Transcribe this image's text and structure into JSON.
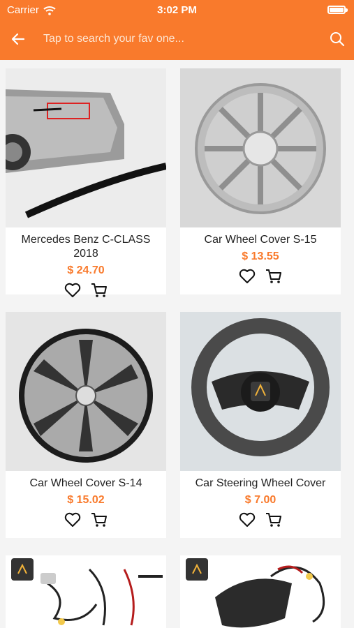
{
  "status_bar": {
    "carrier": "Carrier",
    "time": "3:02 PM"
  },
  "search": {
    "placeholder": "Tap to search your fav one..."
  },
  "colors": {
    "accent": "#f97a2c"
  },
  "products": [
    {
      "name": "Mercedes Benz C-CLASS 2018",
      "price": "$ 24.70",
      "image": "car-spoiler"
    },
    {
      "name": "Car Wheel Cover S-15",
      "price": "$ 13.55",
      "image": "silver-wheel-cover"
    },
    {
      "name": "Car Wheel Cover S-14",
      "price": "$ 15.02",
      "image": "chrome-wheel-cover"
    },
    {
      "name": "Car Steering Wheel Cover",
      "price": "$ 7.00",
      "image": "steering-wheel-cover"
    },
    {
      "name": "",
      "price": "",
      "image": "reverse-camera-kit"
    },
    {
      "name": "",
      "price": "",
      "image": "camera-bracket-kit"
    }
  ]
}
